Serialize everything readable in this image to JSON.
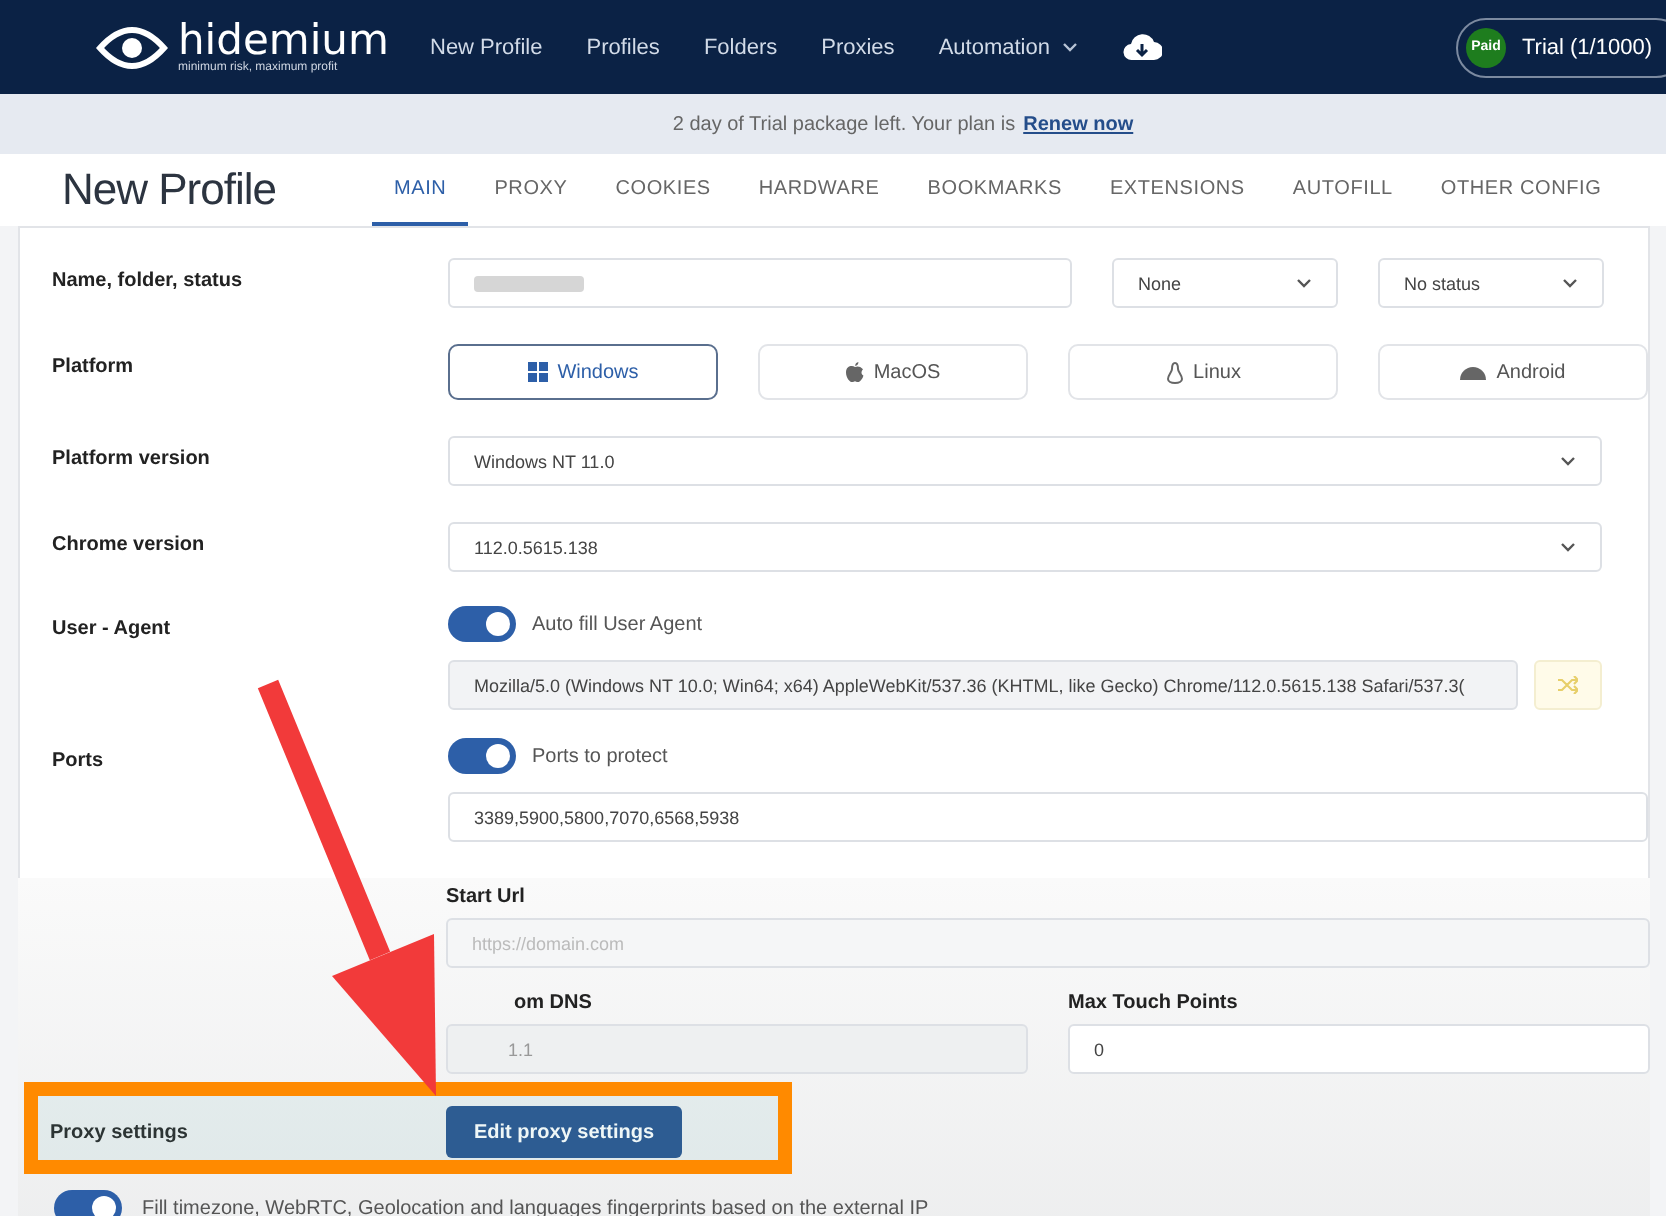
{
  "nav": {
    "logo": "hidemium",
    "tagline": "minimum risk, maximum profit",
    "links": [
      {
        "label": "New Profile",
        "has_caret": false
      },
      {
        "label": "Profiles",
        "has_caret": false
      },
      {
        "label": "Folders",
        "has_caret": false
      },
      {
        "label": "Proxies",
        "has_caret": false
      },
      {
        "label": "Automation",
        "has_caret": true
      }
    ],
    "badge": "Paid",
    "plan": "Trial (1/1000)"
  },
  "banner": {
    "text": "2 day of Trial package left. Your plan is",
    "link": "Renew now"
  },
  "page_title": "New Profile",
  "tabs": [
    {
      "label": "MAIN",
      "selected": true
    },
    {
      "label": "PROXY",
      "selected": false
    },
    {
      "label": "COOKIES",
      "selected": false
    },
    {
      "label": "HARDWARE",
      "selected": false
    },
    {
      "label": "BOOKMARKS",
      "selected": false
    },
    {
      "label": "EXTENSIONS",
      "selected": false
    },
    {
      "label": "AUTOFILL",
      "selected": false
    },
    {
      "label": "OTHER CONFIG",
      "selected": false
    }
  ],
  "name_row": {
    "label": "Name, folder, status",
    "folder": "None",
    "status": "No status"
  },
  "platform": {
    "label": "Platform",
    "options": [
      {
        "label": "Windows",
        "selected": true
      },
      {
        "label": "MacOS",
        "selected": false
      },
      {
        "label": "Linux",
        "selected": false
      },
      {
        "label": "Android",
        "selected": false
      }
    ]
  },
  "platform_version": {
    "label": "Platform version",
    "value": "Windows NT 11.0"
  },
  "chrome_version": {
    "label": "Chrome version",
    "value": "112.0.5615.138"
  },
  "user_agent": {
    "label": "User - Agent",
    "toggle": {
      "label": "Auto fill User Agent",
      "on": true
    },
    "value": "Mozilla/5.0 (Windows NT 10.0; Win64; x64) AppleWebKit/537.36 (KHTML, like Gecko) Chrome/112.0.5615.138 Safari/537.3("
  },
  "ports": {
    "label": "Ports",
    "toggle": {
      "label": "Ports to protect",
      "on": true
    },
    "value": "3389,5900,5800,7070,6568,5938"
  },
  "start_url": {
    "label": "Start Url",
    "placeholder": "https://domain.com"
  },
  "custom_dns": {
    "label": "om DNS",
    "placeholder": "1.1"
  },
  "max_touch": {
    "label": "Max Touch Points",
    "value": "0"
  },
  "proxy_settings": {
    "label": "Proxy settings",
    "button": "Edit proxy settings"
  },
  "fingerprint": {
    "label": "Fill timezone, WebRTC, Geolocation and languages fingerprints based on the external IP",
    "on": true
  }
}
